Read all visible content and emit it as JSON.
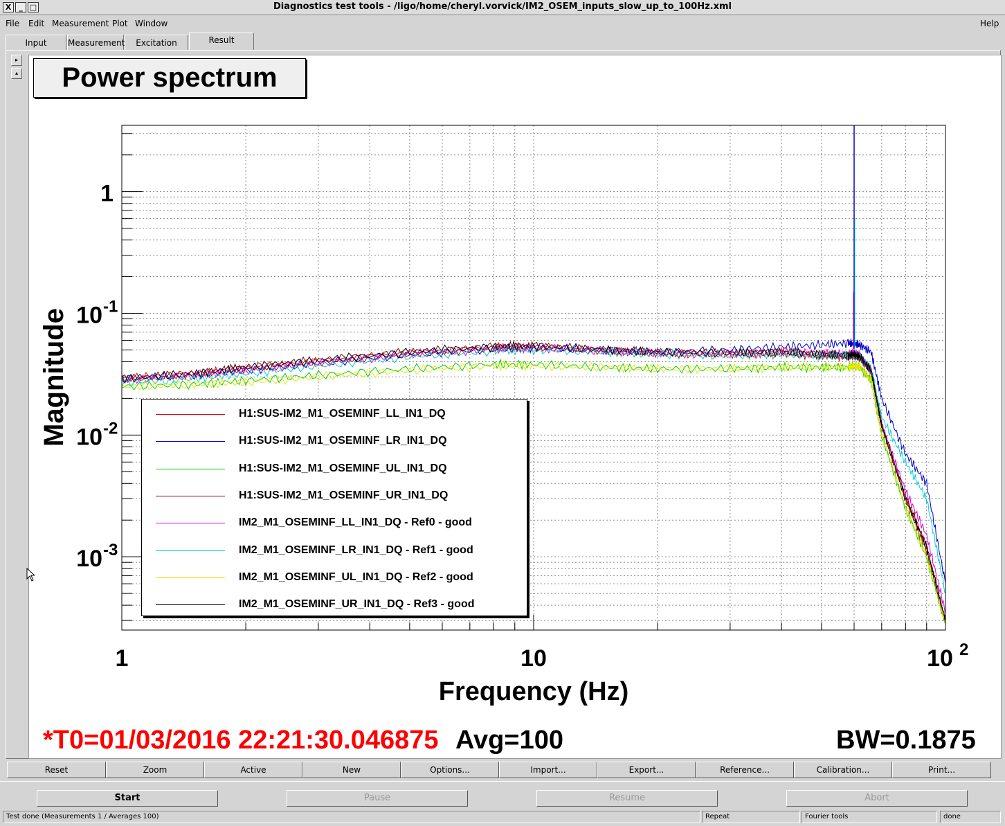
{
  "window": {
    "title": "Diagnostics test tools - /ligo/home/cheryl.vorvick/IM2_OSEM_inputs_slow_up_to_100Hz.xml",
    "close_glyph": "X",
    "minimize_glyph": "_",
    "maximize_glyph": "□"
  },
  "menu": {
    "file": "File",
    "edit": "Edit",
    "measurement": "Measurement",
    "plot": "Plot",
    "window": "Window",
    "help": "Help"
  },
  "tabs": [
    "Input",
    "Measurement",
    "Excitation",
    "Result"
  ],
  "side_buttons": [
    "▸",
    "▴"
  ],
  "plot": {
    "title": "Power spectrum",
    "ylabel": "Magnitude",
    "xlabel": "Frequency (Hz)"
  },
  "legend": [
    "H1:SUS-IM2_M1_OSEMINF_LL_IN1_DQ",
    "H1:SUS-IM2_M1_OSEMINF_LR_IN1_DQ",
    "H1:SUS-IM2_M1_OSEMINF_UL_IN1_DQ",
    "H1:SUS-IM2_M1_OSEMINF_UR_IN1_DQ",
    "IM2_M1_OSEMINF_LL_IN1_DQ - Ref0 - good",
    "IM2_M1_OSEMINF_LR_IN1_DQ - Ref1 - good",
    "IM2_M1_OSEMINF_UL_IN1_DQ - Ref2 - good",
    "IM2_M1_OSEMINF_UR_IN1_DQ - Ref3 - good"
  ],
  "info": {
    "t0": "*T0=01/03/2016 22:21:30.046875",
    "avg": "Avg=100",
    "bw": "BW=0.1875"
  },
  "buttons": [
    "Reset",
    "Zoom",
    "Active",
    "New",
    "Options...",
    "Import...",
    "Export...",
    "Reference...",
    "Calibration...",
    "Print..."
  ],
  "controls": {
    "start": "Start",
    "pause": "Pause",
    "resume": "Resume",
    "abort": "Abort"
  },
  "status": {
    "message": "Test done (Measurements 1 / Averages 100)",
    "mode": "Repeat",
    "tool": "Fourier tools",
    "state": "done"
  },
  "chart_data": {
    "type": "line",
    "title": "Power spectrum",
    "xlabel": "Frequency (Hz)",
    "ylabel": "Magnitude",
    "xscale": "log",
    "yscale": "log",
    "xlim": [
      1,
      100
    ],
    "ylim": [
      0.00025,
      3.5
    ],
    "grid": true,
    "legend_position": "lower-left",
    "x_ticks": [
      {
        "value": 1,
        "label": "1"
      },
      {
        "value": 10,
        "label": "10"
      },
      {
        "value": 100,
        "label": "10",
        "exp": "2"
      }
    ],
    "y_ticks": [
      {
        "value": 1,
        "label": "1",
        "exp": ""
      },
      {
        "value": 0.1,
        "label": "10",
        "exp": "-1"
      },
      {
        "value": 0.01,
        "label": "10",
        "exp": "-2"
      },
      {
        "value": 0.001,
        "label": "10",
        "exp": "-3"
      }
    ],
    "series": [
      {
        "name": "H1:SUS-IM2_M1_OSEMINF_LL_IN1_DQ",
        "color": "#e00000",
        "x": [
          1,
          1.5,
          2,
          3,
          5,
          8,
          10,
          15,
          20,
          30,
          40,
          50,
          58,
          60,
          62,
          66,
          70,
          80,
          90,
          100
        ],
        "y": [
          0.029,
          0.032,
          0.035,
          0.04,
          0.047,
          0.052,
          0.053,
          0.049,
          0.047,
          0.046,
          0.047,
          0.045,
          0.044,
          0.045,
          0.043,
          0.033,
          0.012,
          0.003,
          0.0011,
          0.00028
        ]
      },
      {
        "name": "H1:SUS-IM2_M1_OSEMINF_LR_IN1_DQ",
        "color": "#0000c8",
        "x": [
          1,
          1.5,
          2,
          3,
          5,
          8,
          10,
          15,
          20,
          30,
          40,
          50,
          58,
          60,
          62,
          66,
          70,
          80,
          90,
          100
        ],
        "y": [
          0.029,
          0.031,
          0.034,
          0.039,
          0.046,
          0.051,
          0.052,
          0.05,
          0.048,
          0.05,
          0.053,
          0.055,
          0.057,
          0.056,
          0.055,
          0.048,
          0.02,
          0.007,
          0.004,
          0.0006
        ]
      },
      {
        "name": "H1:SUS-IM2_M1_OSEMINF_UL_IN1_DQ",
        "color": "#00d000",
        "x": [
          1,
          1.5,
          2,
          3,
          5,
          8,
          10,
          15,
          20,
          30,
          40,
          50,
          58,
          60,
          62,
          66,
          70,
          80,
          90,
          100
        ],
        "y": [
          0.025,
          0.026,
          0.028,
          0.031,
          0.035,
          0.038,
          0.038,
          0.036,
          0.035,
          0.035,
          0.036,
          0.036,
          0.036,
          0.037,
          0.036,
          0.028,
          0.01,
          0.0025,
          0.001,
          0.00028
        ]
      },
      {
        "name": "H1:SUS-IM2_M1_OSEMINF_UR_IN1_DQ",
        "color": "#800000",
        "x": [
          1,
          1.5,
          2,
          3,
          5,
          8,
          10,
          15,
          20,
          30,
          40,
          50,
          58,
          60,
          62,
          66,
          70,
          80,
          90,
          100
        ],
        "y": [
          0.029,
          0.032,
          0.036,
          0.041,
          0.048,
          0.053,
          0.054,
          0.05,
          0.048,
          0.047,
          0.048,
          0.046,
          0.045,
          0.046,
          0.044,
          0.034,
          0.012,
          0.0032,
          0.0012,
          0.00029
        ]
      },
      {
        "name": "IM2_M1_OSEMINF_LL_IN1_DQ - Ref0 - good",
        "color": "#e000e0",
        "x": [
          1,
          1.5,
          2,
          3,
          5,
          8,
          10,
          15,
          20,
          30,
          40,
          50,
          58,
          60,
          62,
          66,
          70,
          80,
          90,
          100
        ],
        "y": [
          0.028,
          0.031,
          0.034,
          0.039,
          0.046,
          0.051,
          0.052,
          0.049,
          0.047,
          0.046,
          0.048,
          0.047,
          0.046,
          0.047,
          0.045,
          0.034,
          0.012,
          0.0035,
          0.0015,
          0.00035
        ]
      },
      {
        "name": "IM2_M1_OSEMINF_LR_IN1_DQ - Ref1 - good",
        "color": "#00d0d0",
        "x": [
          1,
          1.5,
          2,
          3,
          5,
          8,
          10,
          15,
          20,
          30,
          40,
          50,
          58,
          60,
          62,
          66,
          70,
          80,
          90,
          100
        ],
        "y": [
          0.027,
          0.029,
          0.032,
          0.037,
          0.044,
          0.049,
          0.05,
          0.048,
          0.046,
          0.045,
          0.046,
          0.045,
          0.045,
          0.045,
          0.044,
          0.035,
          0.014,
          0.006,
          0.003,
          0.0005
        ]
      },
      {
        "name": "IM2_M1_OSEMINF_UL_IN1_DQ - Ref2 - good",
        "color": "#e8e800",
        "x": [
          1,
          1.5,
          2,
          3,
          5,
          8,
          10,
          15,
          20,
          30,
          40,
          50,
          58,
          60,
          62,
          66,
          70,
          80,
          90,
          100
        ],
        "y": [
          0.025,
          0.026,
          0.027,
          0.03,
          0.034,
          0.037,
          0.037,
          0.036,
          0.035,
          0.035,
          0.036,
          0.036,
          0.036,
          0.037,
          0.036,
          0.028,
          0.01,
          0.0025,
          0.001,
          0.00028
        ]
      },
      {
        "name": "IM2_M1_OSEMINF_UR_IN1_DQ - Ref3 - good",
        "color": "#000000",
        "x": [
          1,
          1.5,
          2,
          3,
          5,
          8,
          10,
          15,
          20,
          30,
          40,
          50,
          58,
          60,
          62,
          66,
          70,
          80,
          90,
          100
        ],
        "y": [
          0.029,
          0.032,
          0.036,
          0.041,
          0.048,
          0.053,
          0.054,
          0.05,
          0.048,
          0.047,
          0.048,
          0.046,
          0.045,
          0.046,
          0.044,
          0.034,
          0.012,
          0.003,
          0.0012,
          0.0003
        ]
      }
    ],
    "annotations": [
      {
        "x": 60,
        "peak": 3.5,
        "note": "line at 60 Hz"
      }
    ]
  }
}
